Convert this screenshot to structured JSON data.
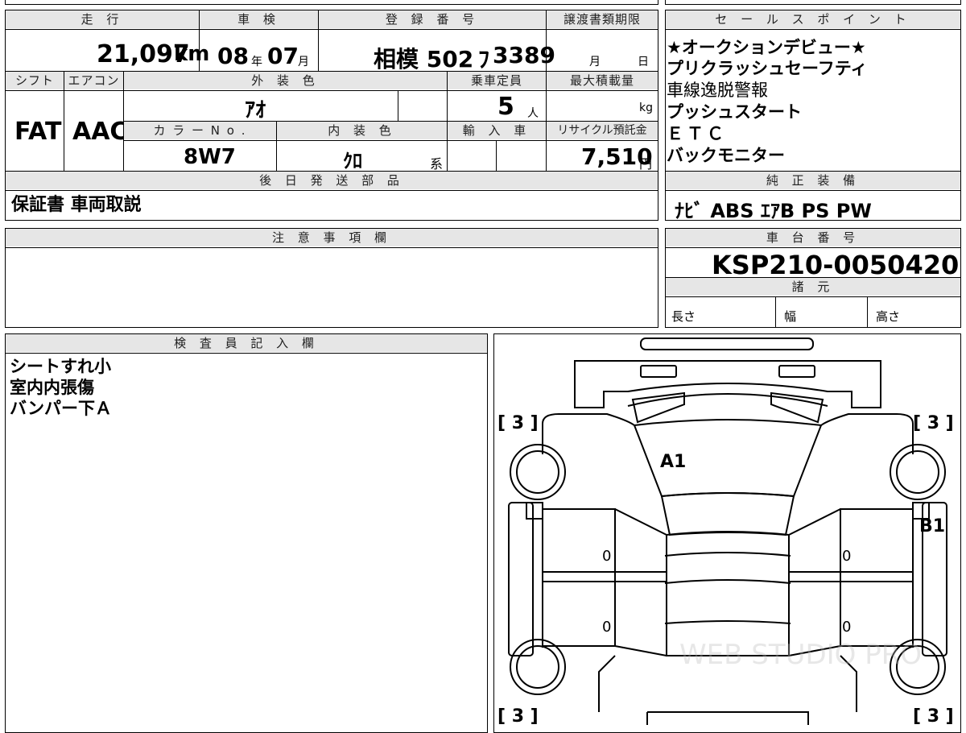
{
  "top": {
    "mileage_label": "走 行",
    "mileage_value": "21,097",
    "mileage_unit": "km",
    "inspection_label": "車 検",
    "inspection_year": "08",
    "inspection_year_unit": "年",
    "inspection_month": "07",
    "inspection_month_unit": "月",
    "registration_label": "登 録 番 号",
    "registration_value": "相模 502",
    "registration_kana": "ﾌ",
    "registration_number": "3389",
    "transfer_label": "譲渡書類期限",
    "transfer_month_unit": "月",
    "transfer_day_unit": "日"
  },
  "row2": {
    "shift_label": "シフト",
    "aircon_label": "エアコン",
    "exterior_label": "外 装 色",
    "capacity_label": "乗車定員",
    "maxload_label": "最大積載量",
    "shift_value": "FAT",
    "aircon_value": "AAC",
    "exterior_value": "ｱｵ",
    "capacity_value": "5",
    "capacity_unit": "人",
    "maxload_unit": "kg",
    "color_no_label": "カ ラ ー N o .",
    "interior_label": "内 装 色",
    "import_label": "輸 入 車",
    "recycle_label": "リサイクル預託金",
    "color_no_value": "8W7",
    "interior_value": "ｸﾛ",
    "interior_suffix": "系",
    "recycle_value": "7,510",
    "recycle_unit": "円"
  },
  "later_parts": {
    "label": "後 日 発 送 部 品",
    "value": "保証書 車両取説"
  },
  "sales_points": {
    "label": "セ ー ル ス ポ イ ン ト",
    "lines": [
      "★オークションデビュー★",
      "プリクラッシュセーフティ",
      "車線逸脱警報",
      "プッシュスタート",
      "ＥＴＣ",
      "バックモニター"
    ]
  },
  "genuine": {
    "label": "純 正 装 備",
    "value": "ﾅﾋﾞ ABS ｴｱB PS PW"
  },
  "notes": {
    "label": "注 意 事 項 欄"
  },
  "chassis": {
    "label": "車 台 番 号",
    "value": "KSP210-0050420",
    "specs_label": "諸 元",
    "length_label": "長さ",
    "width_label": "幅",
    "height_label": "高さ"
  },
  "inspector": {
    "label": "検 査 員 記 入 欄",
    "lines": [
      "シートすれ小",
      "室内内張傷",
      "バンパー下Ａ"
    ]
  },
  "diagram": {
    "tire_tl": "[ 3 ]",
    "tire_tr": "[ 3 ]",
    "tire_bl": "[ 3 ]",
    "tire_br": "[ 3 ]",
    "mark_a1": "A1",
    "mark_b1": "B1",
    "door_fl": "0",
    "door_rl": "0",
    "door_fr": "0",
    "door_rr": "0",
    "watermark": "WEB STUDIO PRO"
  }
}
